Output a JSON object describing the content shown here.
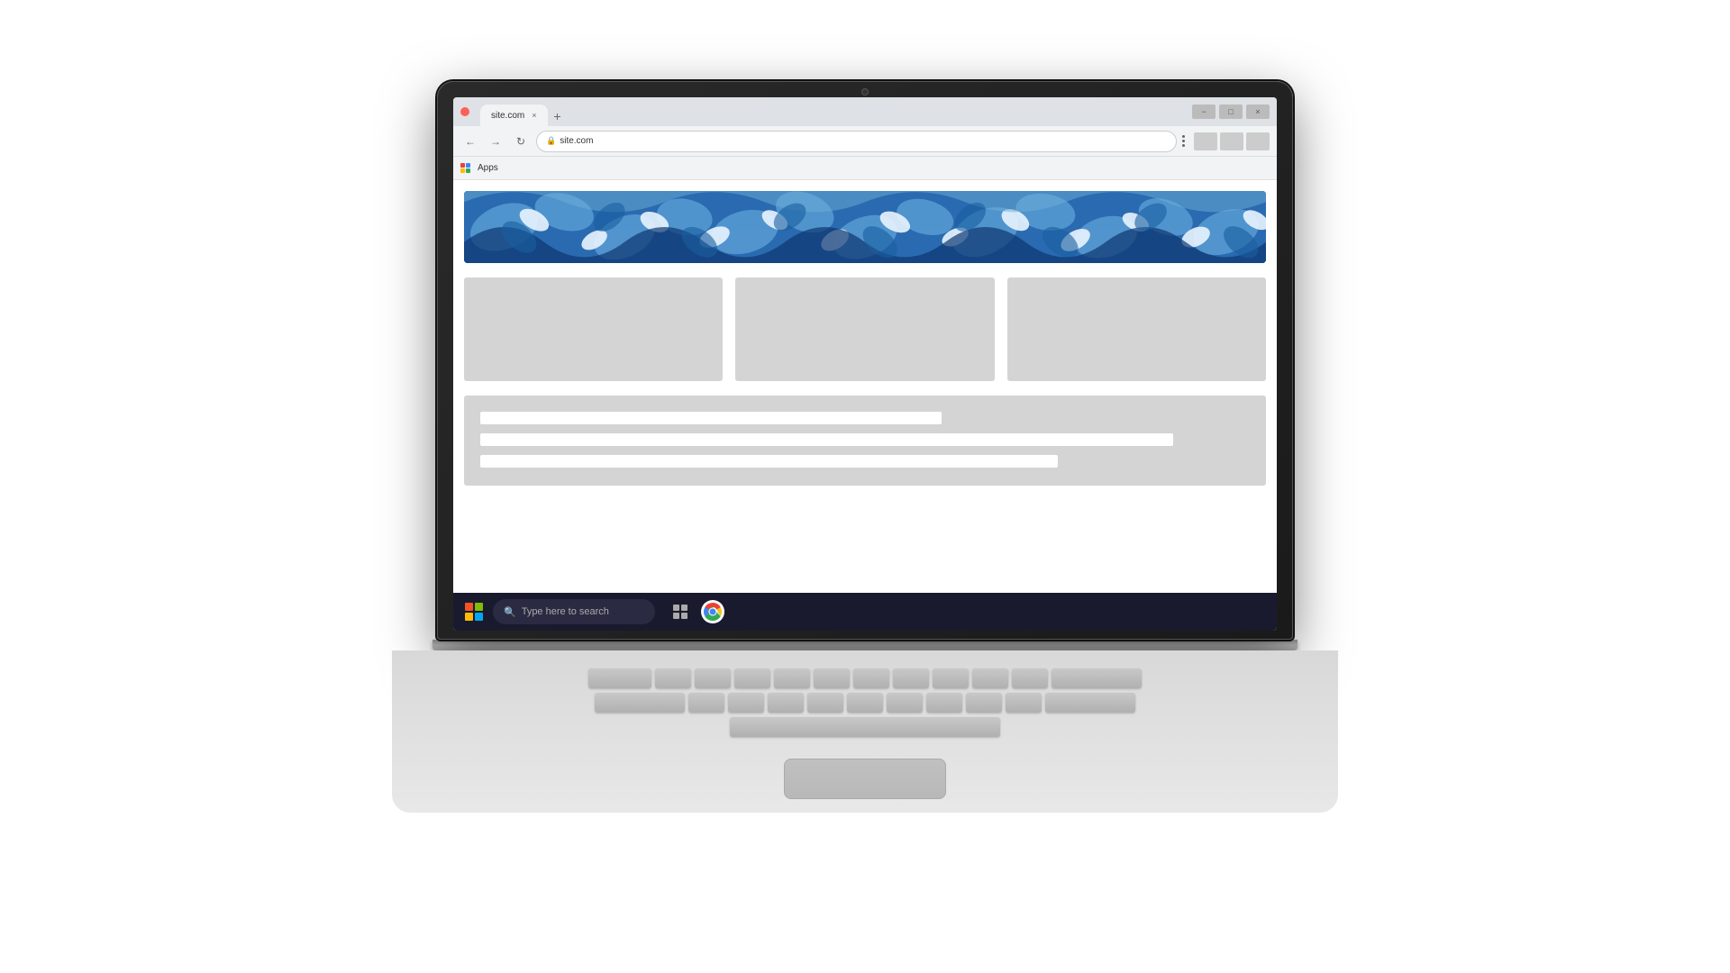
{
  "window": {
    "title": "site.com",
    "tab_label": "site.com",
    "close_btn": "×",
    "minimize_btn": "−",
    "maximize_btn": "□"
  },
  "browser": {
    "back_icon": "←",
    "forward_icon": "→",
    "refresh_icon": "↻",
    "address": "site.com",
    "bookmark_label": "Apps"
  },
  "taskbar": {
    "search_placeholder": "Type here to search",
    "windows_icon": "Windows",
    "chrome_icon": "Chrome"
  },
  "hero": {
    "alt": "Decorative floral banner"
  },
  "cards": [
    {
      "id": 1
    },
    {
      "id": 2
    },
    {
      "id": 3
    }
  ],
  "content_section": {
    "line1_width": "60%",
    "line2_width": "90%",
    "line3_width": "75%"
  }
}
